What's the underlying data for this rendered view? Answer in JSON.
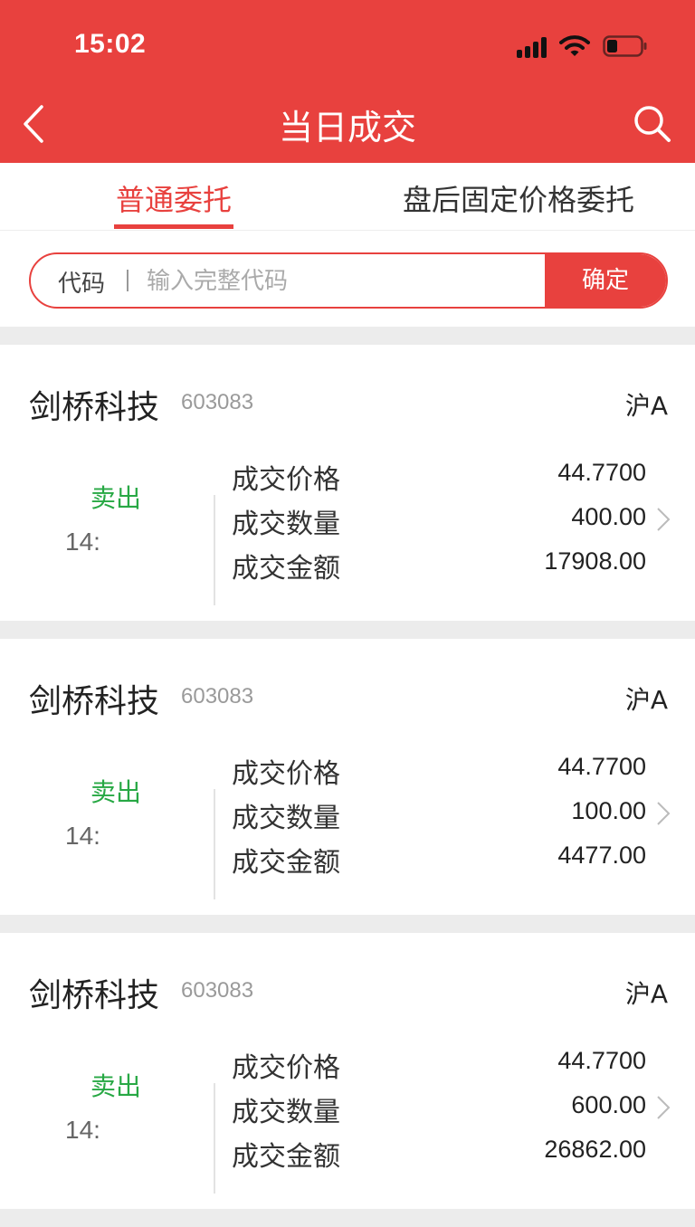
{
  "status_bar": {
    "time": "15:02"
  },
  "nav": {
    "title": "当日成交"
  },
  "tabs": [
    {
      "label": "普通委托",
      "active": true
    },
    {
      "label": "盘后固定价格委托",
      "active": false
    }
  ],
  "search": {
    "label": "代码",
    "placeholder": "输入完整代码",
    "value": "",
    "button": "确定"
  },
  "labels": {
    "price": "成交价格",
    "quantity": "成交数量",
    "amount": "成交金额"
  },
  "trades": [
    {
      "name": "剑桥科技",
      "code": "603083",
      "market": "沪A",
      "direction": "卖出",
      "time": "14:",
      "price": "44.7700",
      "quantity": "400.00",
      "amount": "17908.00"
    },
    {
      "name": "剑桥科技",
      "code": "603083",
      "market": "沪A",
      "direction": "卖出",
      "time": "14:",
      "price": "44.7700",
      "quantity": "100.00",
      "amount": "4477.00"
    },
    {
      "name": "剑桥科技",
      "code": "603083",
      "market": "沪A",
      "direction": "卖出",
      "time": "14:",
      "price": "44.7700",
      "quantity": "600.00",
      "amount": "26862.00"
    }
  ],
  "colors": {
    "brand_red": "#e8413e",
    "sell_green": "#27a844",
    "background": "#ececec"
  },
  "icons": {
    "back": "chevron-left-icon",
    "search": "magnifier-icon",
    "detail": "chevron-right-icon"
  }
}
